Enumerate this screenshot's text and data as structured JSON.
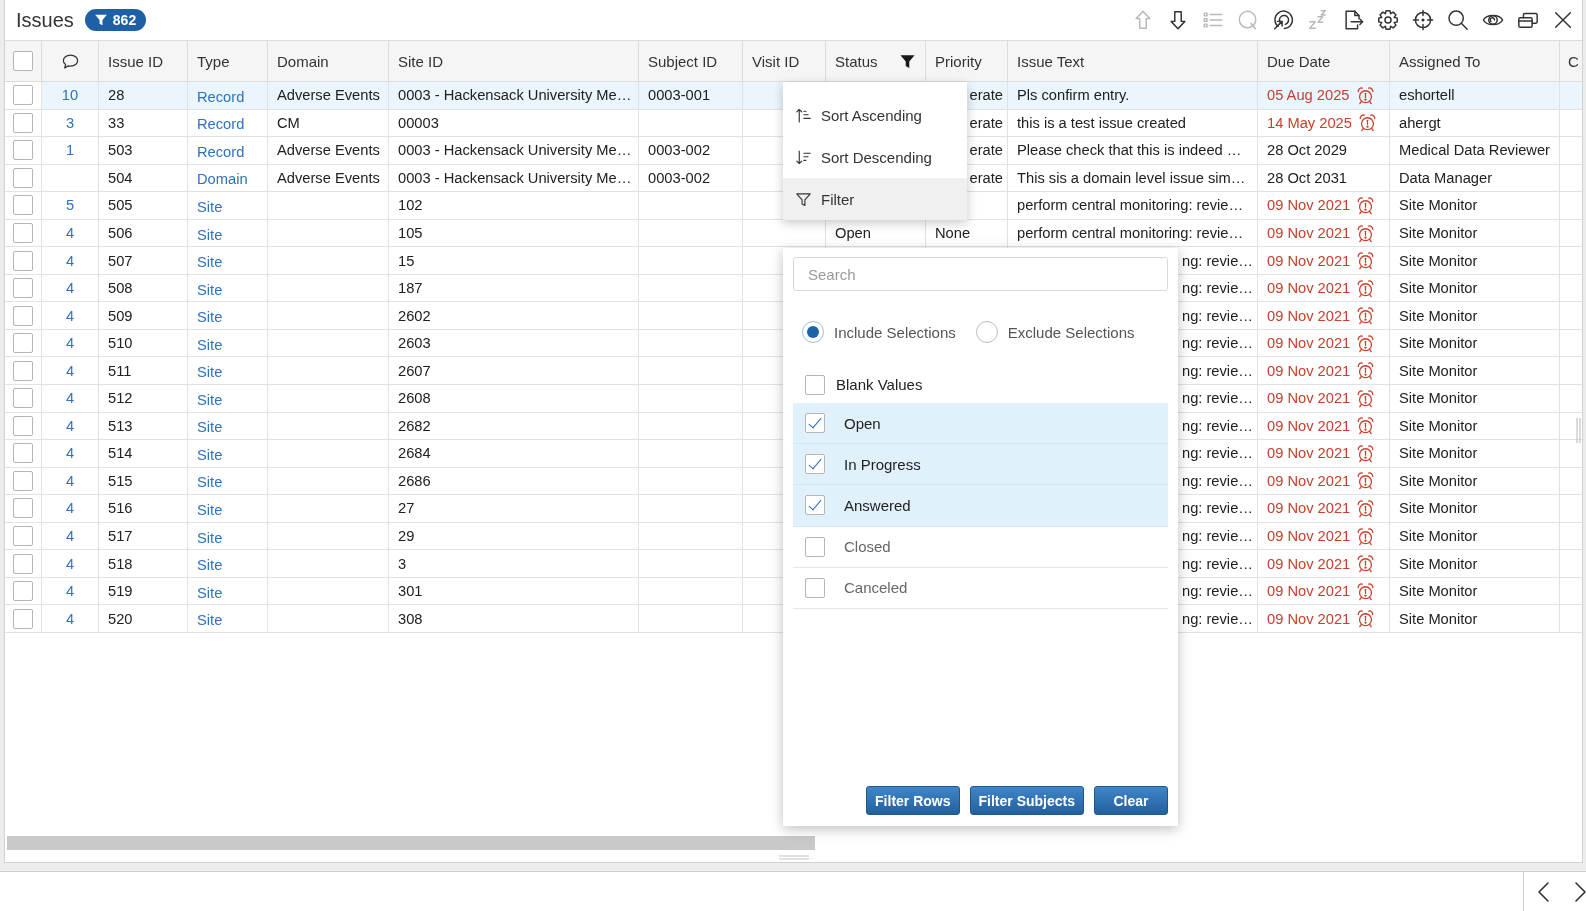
{
  "title": "Issues",
  "filter_badge": {
    "count": "862"
  },
  "toolbar": [
    {
      "kind": "up",
      "disabled": true
    },
    {
      "kind": "down",
      "disabled": false
    },
    {
      "kind": "list",
      "disabled": true
    },
    {
      "kind": "circle_q",
      "disabled": true
    },
    {
      "kind": "spiral",
      "disabled": false
    },
    {
      "kind": "sleep",
      "disabled": true
    },
    {
      "kind": "export",
      "disabled": false
    },
    {
      "kind": "settings",
      "disabled": false
    },
    {
      "kind": "crosshair",
      "disabled": false
    },
    {
      "kind": "search",
      "disabled": false
    },
    {
      "kind": "eye",
      "disabled": false
    },
    {
      "kind": "windows",
      "disabled": false
    },
    {
      "kind": "close",
      "disabled": false
    }
  ],
  "table": {
    "select_all": {
      "checked": false
    },
    "columns": [
      {
        "label": "Issue ID",
        "filtered": false
      },
      {
        "label": "Type",
        "filtered": false
      },
      {
        "label": "Domain",
        "filtered": false
      },
      {
        "label": "Site ID",
        "filtered": false
      },
      {
        "label": "Subject ID",
        "filtered": false
      },
      {
        "label": "Visit ID",
        "filtered": false
      },
      {
        "label": "Status",
        "filtered": true
      },
      {
        "label": "Priority",
        "filtered": false
      },
      {
        "label": "Issue Text",
        "filtered": false
      },
      {
        "label": "Due Date",
        "filtered": false
      },
      {
        "label": "Assigned To",
        "filtered": false
      },
      {
        "label": "C",
        "filtered": false
      }
    ],
    "rows": [
      {
        "selected": true,
        "checked": false,
        "comments": "10",
        "issue_id": "28",
        "type": "Record",
        "domain": "Adverse Events",
        "site_id": "0003 - Hackensack University Me…",
        "subject_id": "0003-001",
        "priority": "erate",
        "issue_text": "Pls confirm entry.",
        "due_date": "05 Aug 2025",
        "overdue": true,
        "assigned_to": "eshortell"
      },
      {
        "selected": false,
        "checked": false,
        "comments": "3",
        "issue_id": "33",
        "type": "Record",
        "domain": "CM",
        "site_id": "00003",
        "priority": "erate",
        "issue_text": "this is a test issue created",
        "due_date": "14 May 2025",
        "overdue": true,
        "assigned_to": "ahergt"
      },
      {
        "selected": false,
        "checked": false,
        "comments": "1",
        "issue_id": "503",
        "type": "Record",
        "domain": "Adverse Events",
        "site_id": "0003 - Hackensack University Me…",
        "subject_id": "0003-002",
        "priority": "erate",
        "issue_text": "Please check that this is indeed …",
        "due_date": "28 Oct 2029",
        "overdue": false,
        "assigned_to": "Medical Data Reviewer"
      },
      {
        "selected": false,
        "checked": false,
        "issue_id": "504",
        "type": "Domain",
        "domain": "Adverse Events",
        "site_id": "0003 - Hackensack University Me…",
        "subject_id": "0003-002",
        "priority": "erate",
        "issue_text": "This sis a domain level issue sim…",
        "due_date": "28 Oct 2031",
        "overdue": false,
        "assigned_to": "Data Manager"
      },
      {
        "selected": false,
        "checked": false,
        "comments": "5",
        "issue_id": "505",
        "type": "Site",
        "site_id": "102",
        "issue_text": "perform central monitoring: revie…",
        "due_date": "09 Nov 2021",
        "overdue": true,
        "assigned_to": "Site Monitor"
      },
      {
        "selected": false,
        "checked": false,
        "comments": "4",
        "issue_id": "506",
        "type": "Site",
        "site_id": "105",
        "status": "Open",
        "priority": "None",
        "issue_text": "perform central monitoring: revie…",
        "due_date": "09 Nov 2021",
        "overdue": true,
        "assigned_to": "Site Monitor"
      },
      {
        "selected": false,
        "checked": false,
        "comments": "4",
        "issue_id": "507",
        "type": "Site",
        "site_id": "15",
        "issue_text": "ng: revie…",
        "due_date": "09 Nov 2021",
        "overdue": true,
        "assigned_to": "Site Monitor"
      },
      {
        "selected": false,
        "checked": false,
        "comments": "4",
        "issue_id": "508",
        "type": "Site",
        "site_id": "187",
        "issue_text": "ng: revie…",
        "due_date": "09 Nov 2021",
        "overdue": true,
        "assigned_to": "Site Monitor"
      },
      {
        "selected": false,
        "checked": false,
        "comments": "4",
        "issue_id": "509",
        "type": "Site",
        "site_id": "2602",
        "issue_text": "ng: revie…",
        "due_date": "09 Nov 2021",
        "overdue": true,
        "assigned_to": "Site Monitor"
      },
      {
        "selected": false,
        "checked": false,
        "comments": "4",
        "issue_id": "510",
        "type": "Site",
        "site_id": "2603",
        "issue_text": "ng: revie…",
        "due_date": "09 Nov 2021",
        "overdue": true,
        "assigned_to": "Site Monitor"
      },
      {
        "selected": false,
        "checked": false,
        "comments": "4",
        "issue_id": "511",
        "type": "Site",
        "site_id": "2607",
        "issue_text": "ng: revie…",
        "due_date": "09 Nov 2021",
        "overdue": true,
        "assigned_to": "Site Monitor"
      },
      {
        "selected": false,
        "checked": false,
        "comments": "4",
        "issue_id": "512",
        "type": "Site",
        "site_id": "2608",
        "issue_text": "ng: revie…",
        "due_date": "09 Nov 2021",
        "overdue": true,
        "assigned_to": "Site Monitor"
      },
      {
        "selected": false,
        "checked": false,
        "comments": "4",
        "issue_id": "513",
        "type": "Site",
        "site_id": "2682",
        "issue_text": "ng: revie…",
        "due_date": "09 Nov 2021",
        "overdue": true,
        "assigned_to": "Site Monitor"
      },
      {
        "selected": false,
        "checked": false,
        "comments": "4",
        "issue_id": "514",
        "type": "Site",
        "site_id": "2684",
        "issue_text": "ng: revie…",
        "due_date": "09 Nov 2021",
        "overdue": true,
        "assigned_to": "Site Monitor"
      },
      {
        "selected": false,
        "checked": false,
        "comments": "4",
        "issue_id": "515",
        "type": "Site",
        "site_id": "2686",
        "issue_text": "ng: revie…",
        "due_date": "09 Nov 2021",
        "overdue": true,
        "assigned_to": "Site Monitor"
      },
      {
        "selected": false,
        "checked": false,
        "comments": "4",
        "issue_id": "516",
        "type": "Site",
        "site_id": "27",
        "issue_text": "ng: revie…",
        "due_date": "09 Nov 2021",
        "overdue": true,
        "assigned_to": "Site Monitor"
      },
      {
        "selected": false,
        "checked": false,
        "comments": "4",
        "issue_id": "517",
        "type": "Site",
        "site_id": "29",
        "issue_text": "ng: revie…",
        "due_date": "09 Nov 2021",
        "overdue": true,
        "assigned_to": "Site Monitor"
      },
      {
        "selected": false,
        "checked": false,
        "comments": "4",
        "issue_id": "518",
        "type": "Site",
        "site_id": "3",
        "issue_text": "ng: revie…",
        "due_date": "09 Nov 2021",
        "overdue": true,
        "assigned_to": "Site Monitor"
      },
      {
        "selected": false,
        "checked": false,
        "comments": "4",
        "issue_id": "519",
        "type": "Site",
        "site_id": "301",
        "issue_text": "ng: revie…",
        "due_date": "09 Nov 2021",
        "overdue": true,
        "assigned_to": "Site Monitor"
      },
      {
        "selected": false,
        "checked": false,
        "comments": "4",
        "issue_id": "520",
        "type": "Site",
        "site_id": "308",
        "issue_text": "ng: revie…",
        "due_date": "09 Nov 2021",
        "overdue": true,
        "assigned_to": "Site Monitor"
      }
    ]
  },
  "column_menu": {
    "items": [
      {
        "kind": "sort_asc",
        "label": "Sort Ascending",
        "selected": false
      },
      {
        "kind": "sort_desc",
        "label": "Sort Descending",
        "selected": false
      },
      {
        "kind": "filter",
        "label": "Filter",
        "selected": true
      }
    ]
  },
  "filter_panel": {
    "search": {
      "placeholder": "Search"
    },
    "modes": [
      {
        "label": "Include Selections",
        "selected": true
      },
      {
        "label": "Exclude Selections",
        "selected": false
      }
    ],
    "options": [
      {
        "kind": "blank",
        "label": "Blank Values",
        "checked": false
      },
      {
        "kind": "value",
        "label": "Open",
        "checked": true
      },
      {
        "kind": "value",
        "label": "In Progress",
        "checked": true
      },
      {
        "kind": "value",
        "label": "Answered",
        "checked": true
      },
      {
        "kind": "value",
        "label": "Closed",
        "checked": false
      },
      {
        "kind": "value",
        "label": "Canceled",
        "checked": false
      }
    ],
    "buttons": [
      "Filter Rows",
      "Filter Subjects",
      "Clear"
    ]
  }
}
